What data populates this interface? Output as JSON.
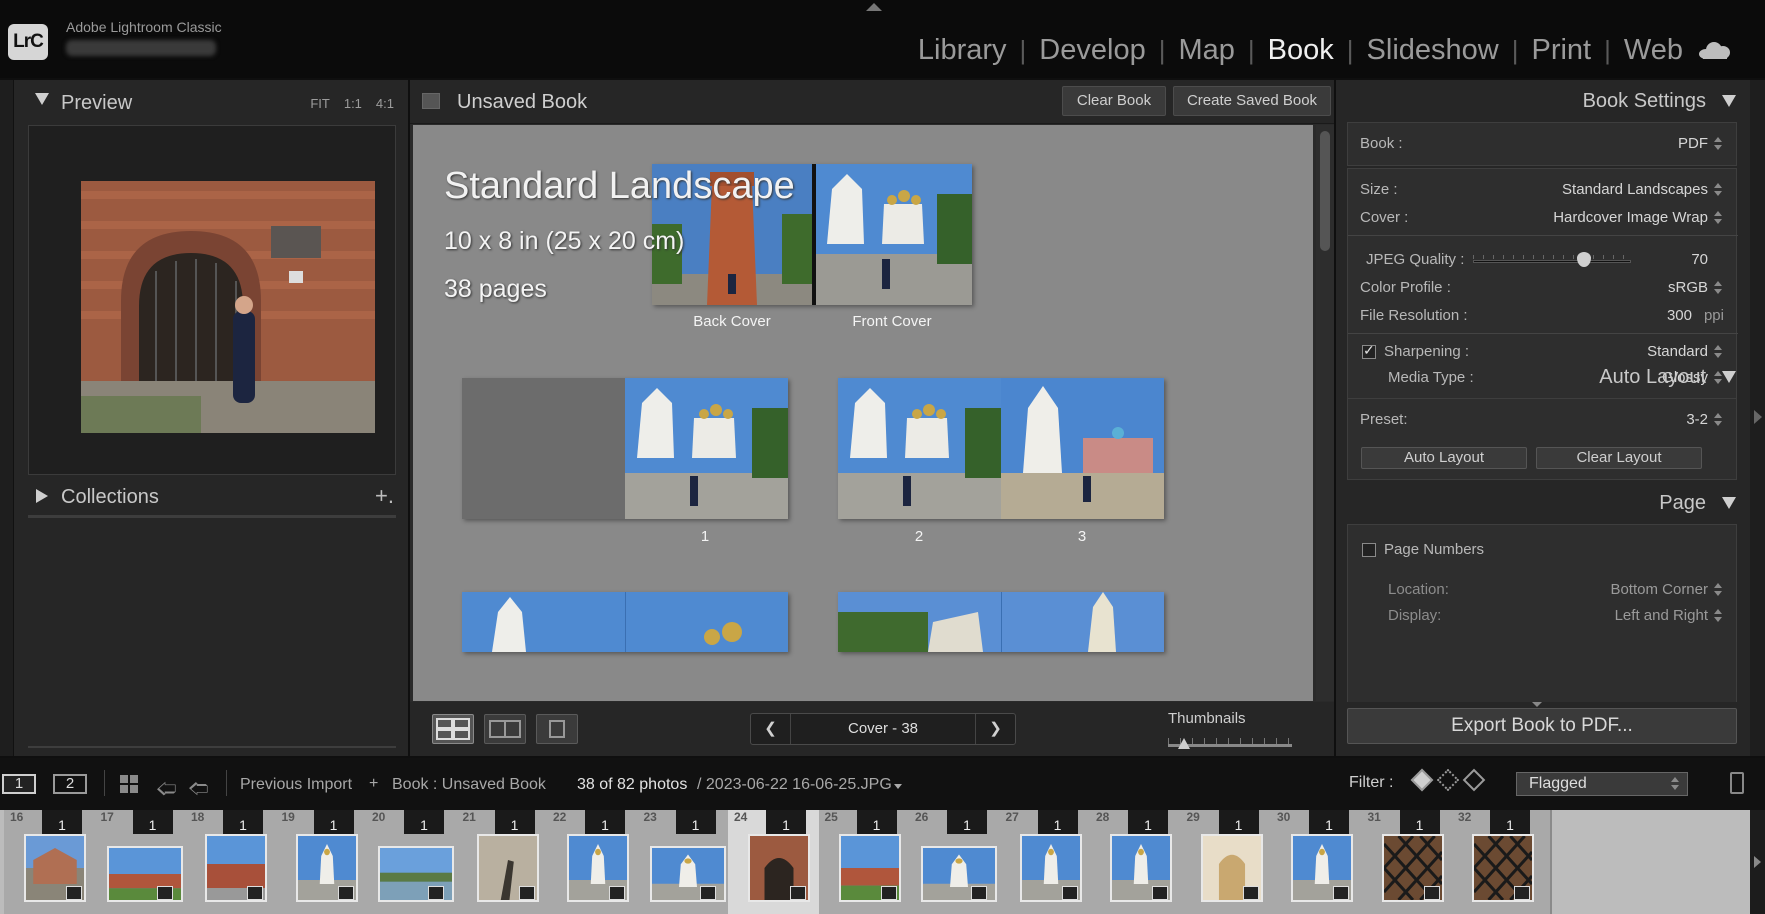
{
  "app": {
    "short_name": "LrC",
    "name": "Adobe Lightroom Classic"
  },
  "modules": [
    "Library",
    "Develop",
    "Map",
    "Book",
    "Slideshow",
    "Print",
    "Web"
  ],
  "active_module": "Book",
  "left_panel": {
    "preview_title": "Preview",
    "zoom_options": [
      "FIT",
      "1:1",
      "4:1"
    ],
    "collections_title": "Collections",
    "add_label": "+."
  },
  "center": {
    "book_title": "Unsaved Book",
    "clear_book": "Clear Book",
    "create_saved_book": "Create Saved Book",
    "book_type": "Standard Landscape",
    "book_size": "10 x 8 in (25 x 20 cm)",
    "book_pages": "38 pages",
    "back_cover_label": "Back Cover",
    "front_cover_label": "Front Cover",
    "page_numbers": [
      "1",
      "2",
      "3"
    ],
    "pager_label": "Cover - 38",
    "thumbnails_label": "Thumbnails",
    "thumbnails_level": 0.13
  },
  "right_panel": {
    "book_settings": {
      "title": "Book Settings",
      "book_label": "Book :",
      "book_value": "PDF",
      "size_label": "Size :",
      "size_value": "Standard Landscapes",
      "cover_label": "Cover :",
      "cover_value": "Hardcover Image Wrap",
      "jpeg_label": "JPEG Quality :",
      "jpeg_value": "70",
      "jpeg_level": 0.7,
      "profile_label": "Color Profile :",
      "profile_value": "sRGB",
      "resolution_label": "File Resolution :",
      "resolution_value": "300",
      "resolution_unit": "ppi",
      "sharpening_label": "Sharpening :",
      "sharpening_value": "Standard",
      "sharpening_checked": true,
      "media_label": "Media Type :",
      "media_value": "Glossy"
    },
    "auto_layout": {
      "title": "Auto Layout",
      "preset_label": "Preset:",
      "preset_value": "3-2",
      "auto_layout_btn": "Auto Layout",
      "clear_layout_btn": "Clear Layout"
    },
    "page": {
      "title": "Page",
      "page_numbers_label": "Page Numbers",
      "page_numbers_checked": false,
      "location_label": "Location:",
      "location_value": "Bottom Corner",
      "display_label": "Display:",
      "display_value": "Left and Right"
    },
    "export_btn": "Export Book to PDF..."
  },
  "filmbar": {
    "screen1": "1",
    "screen2": "2",
    "source_prev": "Previous Import",
    "source_plus": "+",
    "source_book": "Book : Unsaved Book",
    "photo_count": "38 of 82 photos",
    "photo_file": "/ 2023-06-22 16-06-25.JPG",
    "filter_label": "Filter :",
    "filter_value": "Flagged"
  },
  "filmstrip": [
    {
      "num": "16",
      "badge": "1",
      "scene": "house"
    },
    {
      "num": "17",
      "badge": "1",
      "scene": "wall"
    },
    {
      "num": "18",
      "badge": "1",
      "scene": "redwall"
    },
    {
      "num": "19",
      "badge": "1",
      "scene": "church"
    },
    {
      "num": "20",
      "badge": "1",
      "scene": "river"
    },
    {
      "num": "21",
      "badge": "1",
      "scene": "shadow"
    },
    {
      "num": "22",
      "badge": "1",
      "scene": "church"
    },
    {
      "num": "23",
      "badge": "1",
      "scene": "church"
    },
    {
      "num": "24",
      "badge": "1",
      "scene": "gate"
    },
    {
      "num": "25",
      "badge": "1",
      "scene": "wall"
    },
    {
      "num": "26",
      "badge": "1",
      "scene": "church"
    },
    {
      "num": "27",
      "badge": "1",
      "scene": "church"
    },
    {
      "num": "28",
      "badge": "1",
      "scene": "church"
    },
    {
      "num": "29",
      "badge": "1",
      "scene": "arch"
    },
    {
      "num": "30",
      "badge": "1",
      "scene": "church"
    },
    {
      "num": "31",
      "badge": "1",
      "scene": "grille"
    },
    {
      "num": "32",
      "badge": "1",
      "scene": "grille"
    }
  ]
}
